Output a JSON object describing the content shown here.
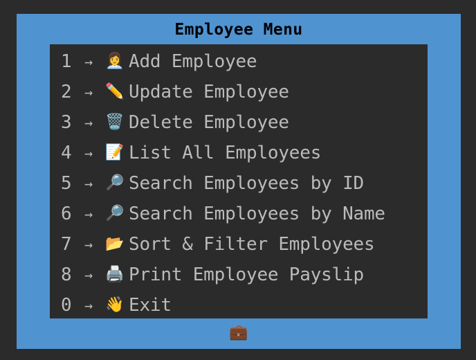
{
  "window": {
    "title": "Employee Menu"
  },
  "colors": {
    "background": "#2b2b2b",
    "frame": "#5093d1",
    "title_text": "#000000",
    "item_text": "#bbbbbb"
  },
  "menu": {
    "arrow": "→",
    "items": [
      {
        "key": "1",
        "icon": "👩‍💼",
        "icon_name": "woman-office-worker-icon",
        "label": "Add Employee"
      },
      {
        "key": "2",
        "icon": "✏️",
        "icon_name": "pencil-icon",
        "label": "Update Employee"
      },
      {
        "key": "3",
        "icon": "🗑️",
        "icon_name": "wastebasket-icon",
        "label": "Delete Employee"
      },
      {
        "key": "4",
        "icon": "📝",
        "icon_name": "memo-icon",
        "label": "List All Employees"
      },
      {
        "key": "5",
        "icon": "🔎",
        "icon_name": "magnifying-glass-icon",
        "label": "Search Employees by ID"
      },
      {
        "key": "6",
        "icon": "🔎",
        "icon_name": "magnifying-glass-icon",
        "label": "Search Employees by Name"
      },
      {
        "key": "7",
        "icon": "📂",
        "icon_name": "open-folder-icon",
        "label": "Sort & Filter Employees"
      },
      {
        "key": "8",
        "icon": "🖨️",
        "icon_name": "printer-icon",
        "label": "Print Employee Payslip"
      },
      {
        "key": "0",
        "icon": "👋",
        "icon_name": "waving-hand-icon",
        "label": "Exit"
      }
    ]
  },
  "footer": {
    "icon": "💼",
    "icon_name": "briefcase-icon"
  }
}
